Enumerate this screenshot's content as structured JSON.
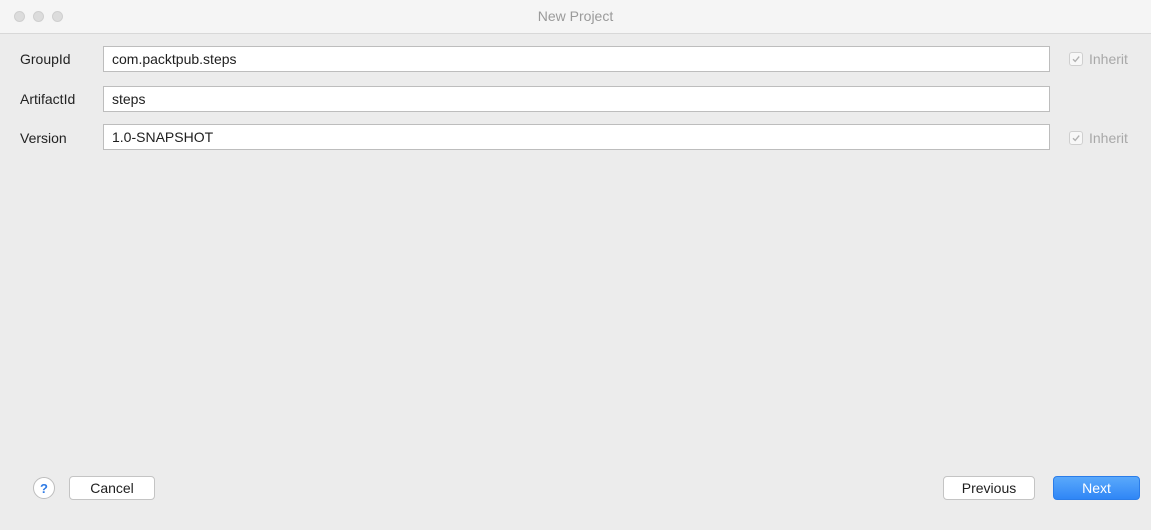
{
  "window": {
    "title": "New Project"
  },
  "form": {
    "rows": [
      {
        "label": "GroupId",
        "value": "com.packtpub.steps",
        "inherit": {
          "label": "Inherit",
          "checked": true
        }
      },
      {
        "label": "ArtifactId",
        "value": "steps"
      },
      {
        "label": "Version",
        "value": "1.0-SNAPSHOT",
        "inherit": {
          "label": "Inherit",
          "checked": true
        }
      }
    ]
  },
  "footer": {
    "help_label": "?",
    "cancel_label": "Cancel",
    "previous_label": "Previous",
    "next_label": "Next"
  },
  "colors": {
    "accent": "#2f86f6",
    "background": "#ececec"
  },
  "icons": {
    "check": "checkmark-icon",
    "help": "help-icon"
  }
}
